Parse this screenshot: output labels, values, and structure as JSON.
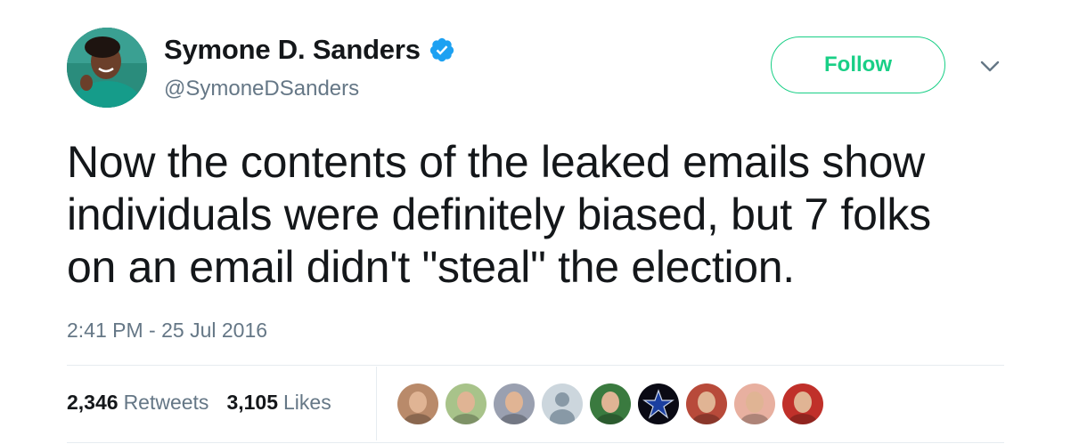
{
  "author": {
    "name": "Symone D. Sanders",
    "handle": "@SymoneDSanders",
    "verified": true,
    "verified_icon": "verified-badge-icon",
    "avatar_icon": "profile-photo"
  },
  "follow_button": {
    "label": "Follow",
    "color": "#19cf86"
  },
  "menu_caret": {
    "icon": "chevron-down-icon"
  },
  "tweet": {
    "text": "Now the contents of the leaked emails show\nindividuals were definitely biased, but 7 folks\non an email didn't \"steal\" the election.",
    "timestamp": "2:41 PM - 25 Jul 2016"
  },
  "stats": {
    "retweets_count": "2,346",
    "retweets_label": "Retweets",
    "likes_count": "3,105",
    "likes_label": "Likes"
  },
  "likers": [
    {
      "icon": "liker-avatar-1",
      "bg": "#b98a6a"
    },
    {
      "icon": "liker-avatar-2",
      "bg": "#a8c38a"
    },
    {
      "icon": "liker-avatar-3",
      "bg": "#9aa0b0"
    },
    {
      "icon": "default-avatar-icon",
      "bg": "#ccd6dd"
    },
    {
      "icon": "liker-avatar-5",
      "bg": "#3a7a3f"
    },
    {
      "icon": "star-logo-avatar",
      "bg": "#0a0a14"
    },
    {
      "icon": "liker-avatar-7",
      "bg": "#b84a3a"
    },
    {
      "icon": "liker-avatar-8",
      "bg": "#e8b0a0"
    },
    {
      "icon": "liker-avatar-9",
      "bg": "#c0302a"
    }
  ],
  "colors": {
    "text_primary": "#14171a",
    "text_secondary": "#657786",
    "verified_blue": "#1da1f2",
    "divider": "#e6ecf0"
  }
}
